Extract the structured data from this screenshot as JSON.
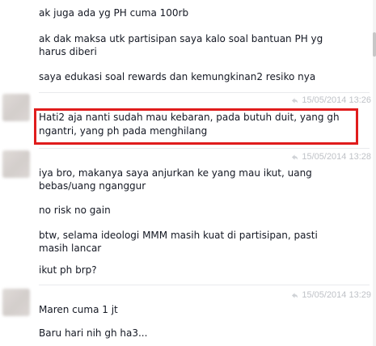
{
  "messages": [
    {
      "text": "ak juga ada yg PH cuma 100rb"
    },
    {
      "text": "ak dak maksa utk partisipan saya kalo soal bantuan PH yg",
      "text2": "harus diberi"
    },
    {
      "text": "saya edukasi soal rewards dan kemungkinan2 resiko nya"
    },
    {
      "timestamp": "15/05/2014 13:26",
      "text": "Hati2 aja nanti sudah mau kebaran, pada butuh duit, yang gh",
      "text2": "ngantri, yang ph pada menghilang"
    },
    {
      "timestamp": "15/05/2014 13:28",
      "text": "iya bro, makanya saya anjurkan ke yang mau ikut, uang",
      "text2": "bebas/uang nganggur"
    },
    {
      "text": "no risk no gain"
    },
    {
      "text": "btw, selama ideologi MMM masih kuat di partisipan, pasti",
      "text2": "masih lancar"
    },
    {
      "text": "ikut ph brp?"
    },
    {
      "timestamp": "15/05/2014 13:29",
      "text": "Maren cuma 1 jt"
    },
    {
      "text": "Baru hari nih gh ha3..."
    }
  ],
  "icons": {
    "timestamp": "reply-arrow-icon"
  },
  "colors": {
    "highlight_border": "#e01d1d",
    "timestamp_text": "#bfc2c7",
    "message_text": "#141823"
  }
}
